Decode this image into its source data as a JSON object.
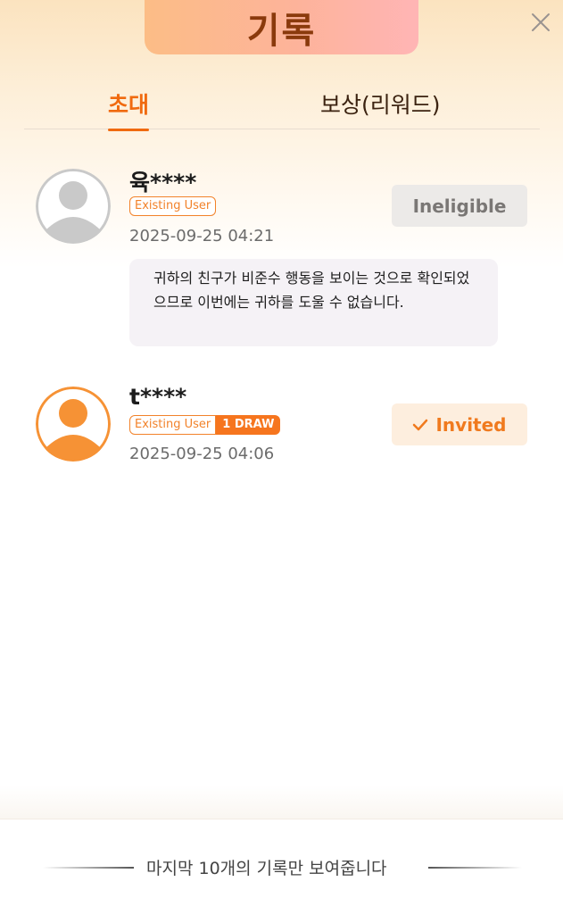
{
  "header": {
    "title": "기록",
    "close_icon": "close-icon"
  },
  "tabs": [
    {
      "label": "초대",
      "active": true
    },
    {
      "label": "보상(리워드)",
      "active": false
    }
  ],
  "records": [
    {
      "username": "육****",
      "badge": "Existing User",
      "date": "2025-09-25 04:21",
      "status": "Ineligible",
      "note": "귀하의 친구가 비준수 행동을 보이는 것으로 확인되었으므로 이번에는 귀하를 도울 수 없습니다.",
      "avatar_color": "#c9c9c9"
    },
    {
      "username": "t****",
      "badge": "Existing User",
      "extra_badge": "1 DRAW",
      "date": "2025-09-25 04:06",
      "status": "Invited",
      "status_icon": "check-icon",
      "avatar_color": "#f69235"
    }
  ],
  "footer": {
    "text": "마지막 10개의 기록만 보여줍니다"
  },
  "colors": {
    "accent": "#f06a0f",
    "title": "#8a3a0c",
    "invited_bg": "#fdeede",
    "ineligible_bg": "#eceae8"
  }
}
